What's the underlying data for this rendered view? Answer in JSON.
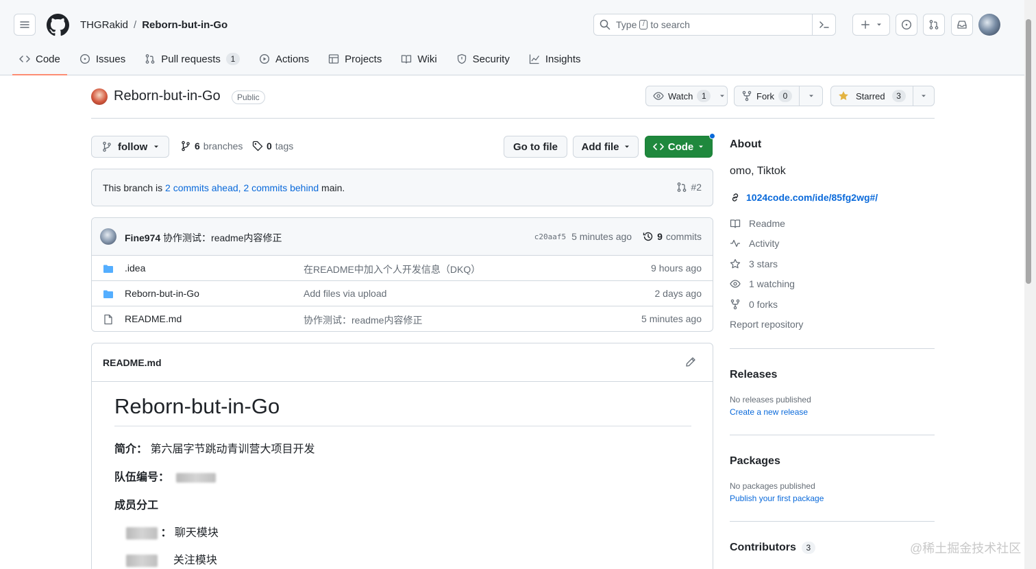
{
  "header": {
    "owner": "THGRakid",
    "separator": "/",
    "repo": "Reborn-but-in-Go",
    "search_prefix": "Type",
    "search_key": "/",
    "search_suffix": "to search"
  },
  "tabs": [
    {
      "label": "Code",
      "icon": "code-icon",
      "active": true
    },
    {
      "label": "Issues",
      "icon": "issue-icon"
    },
    {
      "label": "Pull requests",
      "icon": "pull-request-icon",
      "count": "1"
    },
    {
      "label": "Actions",
      "icon": "play-icon"
    },
    {
      "label": "Projects",
      "icon": "table-icon"
    },
    {
      "label": "Wiki",
      "icon": "book-icon"
    },
    {
      "label": "Security",
      "icon": "shield-icon"
    },
    {
      "label": "Insights",
      "icon": "graph-icon"
    }
  ],
  "repo_head": {
    "name": "Reborn-but-in-Go",
    "visibility": "Public",
    "watch_label": "Watch",
    "watch_count": "1",
    "fork_label": "Fork",
    "fork_count": "0",
    "star_label": "Starred",
    "star_count": "3"
  },
  "branch_bar": {
    "branch": "follow",
    "branches_count": "6",
    "branches_label": "branches",
    "tags_count": "0",
    "tags_label": "tags",
    "go_to_file": "Go to file",
    "add_file": "Add file",
    "code": "Code"
  },
  "ahead": {
    "prefix": "This branch is",
    "ahead_link": "2 commits ahead,",
    "behind_link": "2 commits behind",
    "suffix": "main.",
    "pr": "#2"
  },
  "commit": {
    "author": "Fine974",
    "message": "协作测试：readme内容修正",
    "sha": "c20aaf5",
    "time": "5 minutes ago",
    "commits_count": "9",
    "commits_label": "commits"
  },
  "files": [
    {
      "type": "folder",
      "name": ".idea",
      "message": "在README中加入个人开发信息（DKQ）",
      "age": "9 hours ago"
    },
    {
      "type": "folder",
      "name": "Reborn-but-in-Go",
      "message": "Add files via upload",
      "age": "2 days ago"
    },
    {
      "type": "file",
      "name": "README.md",
      "message": "协作测试：readme内容修正",
      "age": "5 minutes ago"
    }
  ],
  "readme": {
    "file": "README.md",
    "title": "Reborn-but-in-Go",
    "intro_label": "简介：",
    "intro_text": "第六届字节跳动青训营大项目开发",
    "team_label": "队伍编号：",
    "members_heading": "成员分工",
    "member1_role": "聊天模块",
    "member2_role": "关注模块"
  },
  "about": {
    "heading": "About",
    "description": "omo, Tiktok",
    "link": "1024code.com/ide/85fg2wg#/",
    "items": [
      {
        "icon": "book-icon",
        "label": "Readme"
      },
      {
        "icon": "pulse-icon",
        "label": "Activity"
      },
      {
        "icon": "star-icon",
        "label": "3 stars"
      },
      {
        "icon": "eye-icon",
        "label": "1 watching"
      },
      {
        "icon": "fork-icon",
        "label": "0 forks"
      }
    ],
    "report": "Report repository"
  },
  "releases": {
    "heading": "Releases",
    "empty": "No releases published",
    "action": "Create a new release"
  },
  "packages": {
    "heading": "Packages",
    "empty": "No packages published",
    "action": "Publish your first package"
  },
  "contributors": {
    "heading": "Contributors",
    "count": "3"
  },
  "watermark": "@稀土掘金技术社区",
  "colors": {
    "primary_green": "#1f883d",
    "link_blue": "#0969da",
    "tab_underline": "#fd8c73",
    "folder_blue": "#54aeff",
    "star_yellow": "#e3b341"
  }
}
